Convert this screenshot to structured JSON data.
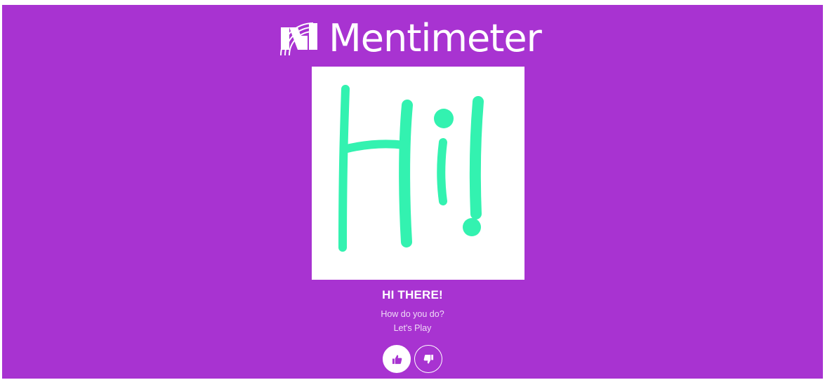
{
  "brand": {
    "name": "Mentimeter",
    "background_color": "#a833d1",
    "drawing_color": "#33f2b0"
  },
  "slide": {
    "image_text": "Hi!",
    "title": "HI THERE!",
    "subtitle_line1": "How do you do?",
    "subtitle_line2": "Let's Play"
  },
  "reactions": {
    "like_icon": "thumbs-up-icon",
    "dislike_icon": "thumbs-down-icon"
  }
}
